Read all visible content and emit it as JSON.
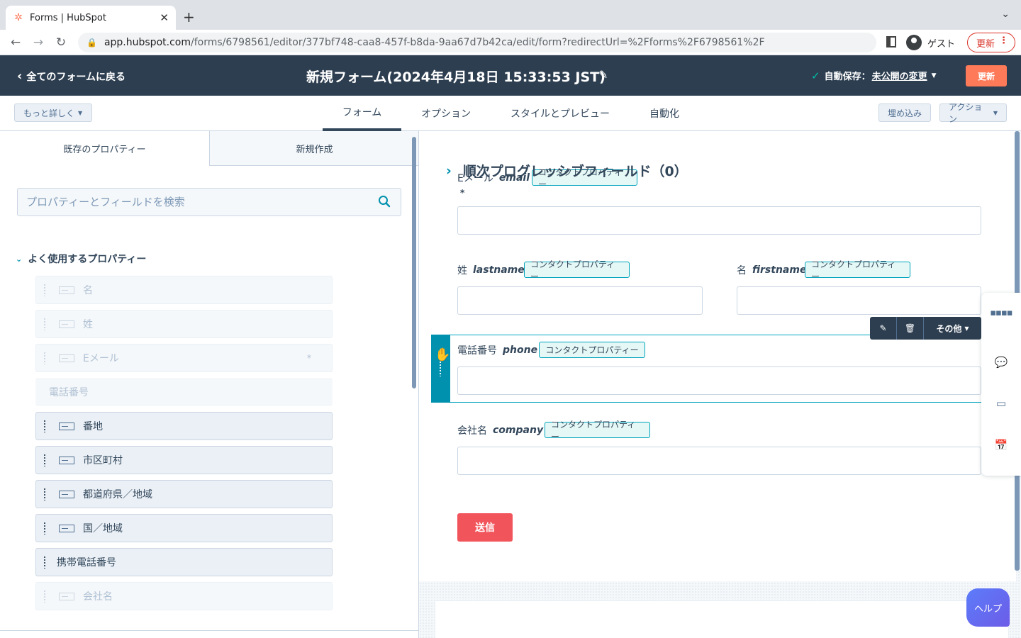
{
  "browser": {
    "tab_title": "Forms | HubSpot",
    "favicon": "hubspot-sprocket",
    "new_tab": "+",
    "url_host": "app.hubspot.com",
    "url_path": "/forms/6798561/editor/377bf748-caa8-457f-b8da-9aa67d7b42ca/edit/form?redirectUrl=%2Fforms%2F6798561%2F",
    "profile_label": "ゲスト",
    "update_label": "更新"
  },
  "header": {
    "back_label": "全てのフォームに戻る",
    "title": "新規フォーム(2024年4月18日 15:33:53 JST)",
    "autosave_label": "自動保存：",
    "autosave_link": "未公開の変更",
    "update_button": "更新"
  },
  "toolbar": {
    "more_details": "もっと詳しく",
    "tabs": [
      {
        "label": "フォーム",
        "active": true
      },
      {
        "label": "オプション",
        "active": false
      },
      {
        "label": "スタイルとプレビュー",
        "active": false
      },
      {
        "label": "自動化",
        "active": false
      }
    ],
    "embed": "埋め込み",
    "actions": "アクション"
  },
  "left_panel": {
    "tab_existing": "既存のプロパティー",
    "tab_new": "新規作成",
    "search_placeholder": "プロパティーとフィールドを検索",
    "section_title": "よく使用するプロパティー",
    "items": [
      {
        "label": "名",
        "used": true,
        "icon": "text-field-icon"
      },
      {
        "label": "姓",
        "used": true,
        "icon": "text-field-icon"
      },
      {
        "label": "Eメール",
        "used": true,
        "icon": "text-field-icon",
        "required": "*"
      },
      {
        "label": "電話番号",
        "used": true,
        "icon": ""
      },
      {
        "label": "番地",
        "used": false,
        "icon": "text-field-icon"
      },
      {
        "label": "市区町村",
        "used": false,
        "icon": "text-field-icon"
      },
      {
        "label": "都道府県／地域",
        "used": false,
        "icon": "text-field-icon"
      },
      {
        "label": "国／地域",
        "used": false,
        "icon": "text-field-icon"
      },
      {
        "label": "携帯電話番号",
        "used": false,
        "icon": ""
      },
      {
        "label": "会社名",
        "used": true,
        "icon": "text-field-icon"
      }
    ]
  },
  "form": {
    "property_tag": "コンタクトプロパティー",
    "email": {
      "label": "Eメール",
      "internal": "email",
      "required": "*"
    },
    "lastname": {
      "label": "姓",
      "internal": "lastname"
    },
    "firstname": {
      "label": "名",
      "internal": "firstname"
    },
    "phone": {
      "label": "電話番号",
      "internal": "phone"
    },
    "company": {
      "label": "会社名",
      "internal": "company"
    },
    "field_toolbar_more": "その他",
    "submit": "送信",
    "progressive_title": "順次プログレッシブフィールド（0）"
  },
  "help_button": "ヘルプ",
  "colors": {
    "header_bg": "#2d3e50",
    "accent_orange": "#ff7a59",
    "submit_red": "#f2545b",
    "teal": "#0091ae"
  }
}
